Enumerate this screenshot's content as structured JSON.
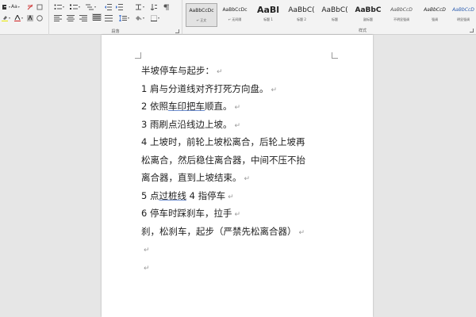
{
  "ribbon": {
    "font_size_label": "Aa",
    "group_paragraph_label": "段落",
    "group_styles_label": "样式",
    "styles": [
      {
        "sample": "AaBbCcDc",
        "name": "↵ 正文"
      },
      {
        "sample": "AaBbCcDc",
        "name": "↵ 无间隔"
      },
      {
        "sample": "AaBl",
        "name": "标题 1"
      },
      {
        "sample": "AaBbC(",
        "name": "标题 2"
      },
      {
        "sample": "AaBbC(",
        "name": "标题"
      },
      {
        "sample": "AaBbC",
        "name": "副标题"
      },
      {
        "sample": "AaBbCcD",
        "name": "不明显强调"
      },
      {
        "sample": "AaBbCcD",
        "name": "强调"
      },
      {
        "sample": "AaBbCcD",
        "name": "明显强调"
      }
    ]
  },
  "document": {
    "paragraph_mark": "↵",
    "lines": [
      {
        "parts": [
          {
            "t": "半坡停车与起步："
          }
        ]
      },
      {
        "parts": [
          {
            "t": "1 肩与分道线对齐打死方向盘。"
          }
        ]
      },
      {
        "parts": [
          {
            "t": "2 依照"
          },
          {
            "t": "车印把车",
            "u": true
          },
          {
            "t": "顺直。"
          }
        ]
      },
      {
        "parts": [
          {
            "t": "3 雨刷点沿线边上坡。"
          }
        ]
      },
      {
        "parts": [
          {
            "t": "4 上坡时，前轮上坡松离合，后轮上坡再"
          }
        ],
        "nomark": true
      },
      {
        "parts": [
          {
            "t": "松离合，然后稳住离合器，中间不压不抬"
          }
        ],
        "nomark": true
      },
      {
        "parts": [
          {
            "t": "离合器，直到上坡结束。"
          }
        ]
      },
      {
        "parts": [
          {
            "t": "5 点"
          },
          {
            "t": "过桩线",
            "u": true
          },
          {
            "t": " 4 指停车"
          }
        ]
      },
      {
        "parts": [
          {
            "t": "6 停车时踩刹车，拉手"
          }
        ]
      },
      {
        "parts": [
          {
            "t": "刹，松刹车，起步（严禁先松离合器）"
          }
        ]
      },
      {
        "parts": [
          {
            "t": ""
          }
        ]
      },
      {
        "parts": [
          {
            "t": ""
          }
        ]
      }
    ]
  }
}
